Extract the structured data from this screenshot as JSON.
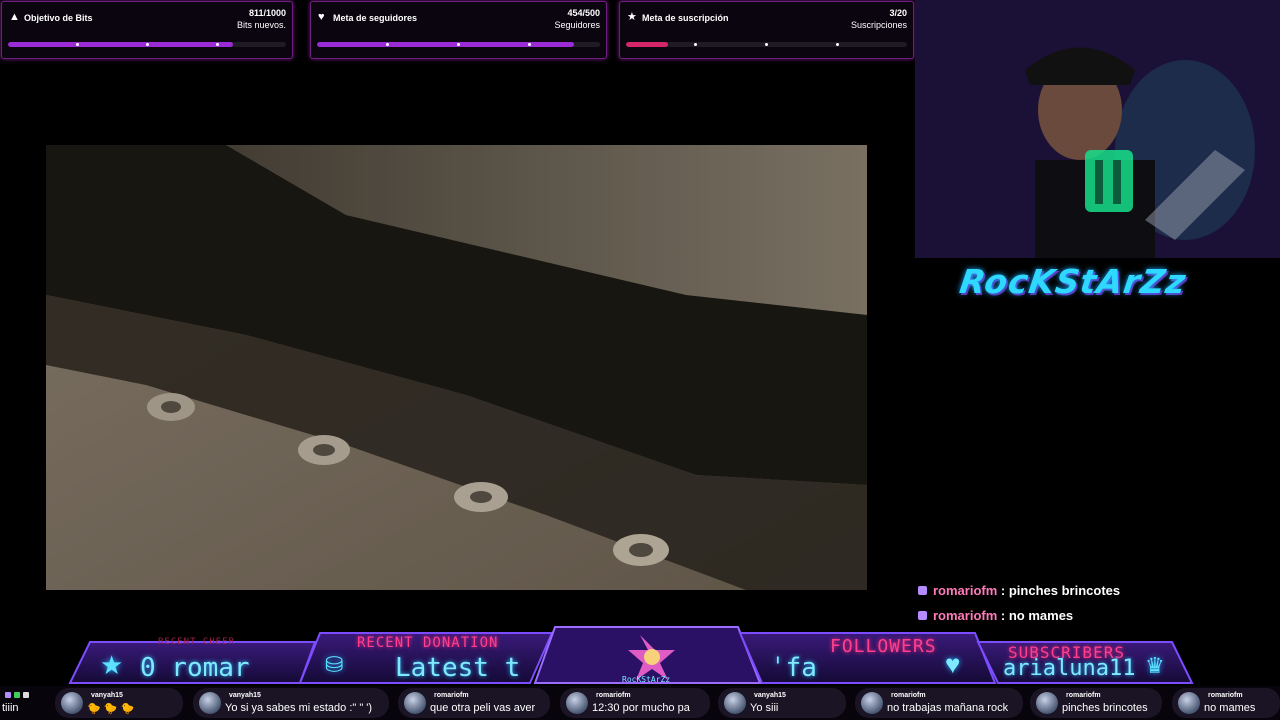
{
  "goals": [
    {
      "icon": "bits-icon",
      "glyph": "▲",
      "title": "Objetivo de Bits",
      "count": "811/1000",
      "subtitle": "Bits nuevos.",
      "progress": 0.811,
      "color": "#9a2bd6"
    },
    {
      "icon": "heart-icon",
      "glyph": "♥",
      "title": "Meta de seguidores",
      "count": "454/500",
      "subtitle": "Seguidores",
      "progress": 0.908,
      "color": "#9a2bd6"
    },
    {
      "icon": "star-icon",
      "glyph": "★",
      "title": "Meta de suscripción",
      "count": "3/20",
      "subtitle": "Suscripciones",
      "progress": 0.15,
      "color": "#d6266a"
    }
  ],
  "brand": "RocKStArZz",
  "chat": [
    {
      "user": "romariofm",
      "message": ": pinches brincotes"
    },
    {
      "user": "romariofm",
      "message": ": no mames"
    }
  ],
  "bar": {
    "recent_cheer": {
      "title": "RECENT CHEER",
      "value": "0  romar"
    },
    "recent_donation": {
      "title": "RECENT DONATION",
      "value": "Latest t"
    },
    "logo_text": "RocKStArZz",
    "followers": {
      "title": "FOLLOWERS",
      "value": "ˈfa"
    },
    "subscribers": {
      "title": "SUBSCRIBERS",
      "value": "arialuna11"
    }
  },
  "ticker": [
    {
      "name": "",
      "message": "tiiin"
    },
    {
      "name": "vanyah15",
      "message": "🐤 🐤 🐤"
    },
    {
      "name": "vanyah15",
      "message": "Yo si ya sabes mi estado :\"  \" ')"
    },
    {
      "name": "romariofm",
      "message": "que otra peli vas aver"
    },
    {
      "name": "romariofm",
      "message": "12:30 por mucho pa"
    },
    {
      "name": "vanyah15",
      "message": "Yo siii"
    },
    {
      "name": "romariofm",
      "message": "no trabajas mañana rock"
    },
    {
      "name": "romariofm",
      "message": "pinches brincotes"
    },
    {
      "name": "romariofm",
      "message": "no mames"
    }
  ]
}
